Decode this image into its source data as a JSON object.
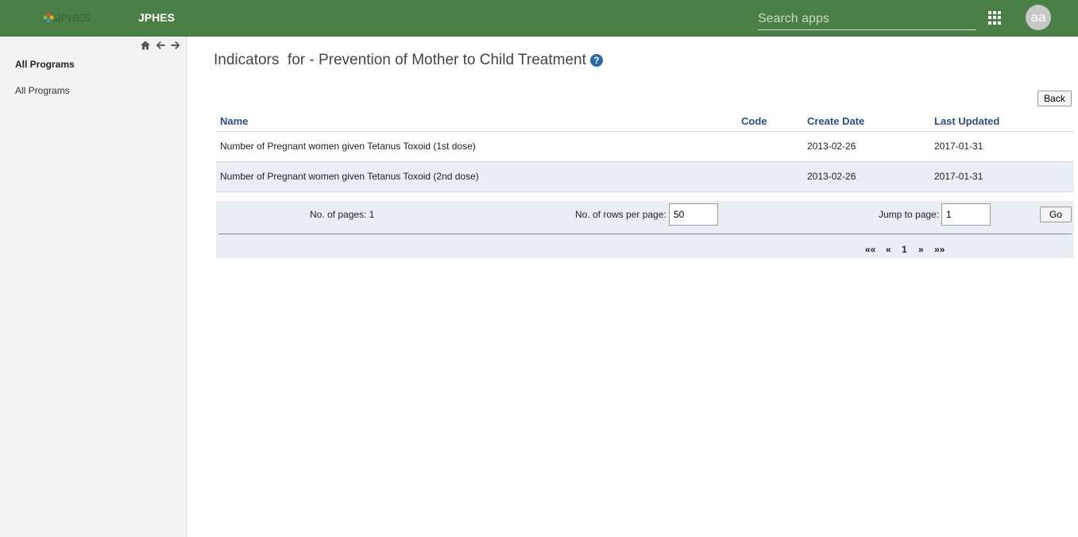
{
  "header": {
    "logo_text": "JPHES",
    "app_title": "JPHES",
    "search_placeholder": "Search apps",
    "apps_icon": "apps-grid-icon",
    "avatar_initials": "aa",
    "colors": {
      "bar": "#4a7f45",
      "logo_text": "#3d6a3a"
    }
  },
  "sidebar": {
    "nav_icons": [
      "home-icon",
      "arrow-left-icon",
      "arrow-right-icon"
    ],
    "heading": "All Programs",
    "link": "All Programs"
  },
  "main": {
    "title": "Indicators  for - Prevention of Mother to Child Treatment",
    "help_icon": "help-circle-icon",
    "back_label": "Back",
    "table": {
      "columns": [
        "Name",
        "Code",
        "Create Date",
        "Last Updated"
      ],
      "rows": [
        {
          "name": "Number of Pregnant women given Tetanus Toxoid (1st dose)",
          "code": "",
          "create_date": "2013-02-26",
          "last_updated": "2017-01-31"
        },
        {
          "name": "Number of Pregnant women given Tetanus Toxoid (2nd dose)",
          "code": "",
          "create_date": "2013-02-26",
          "last_updated": "2017-01-31"
        }
      ]
    },
    "pager": {
      "pages_label": "No. of pages: 1",
      "rows_label": "No. of rows per page:",
      "rows_value": "50",
      "jump_label": "Jump to page:",
      "jump_value": "1",
      "go_label": "Go",
      "first": "««",
      "prev": "«",
      "current": "1",
      "next": "»",
      "last": "»»"
    },
    "colors": {
      "header_text": "#2c4f86",
      "alt_row": "#e9eef5",
      "help": "#296aa4"
    }
  }
}
